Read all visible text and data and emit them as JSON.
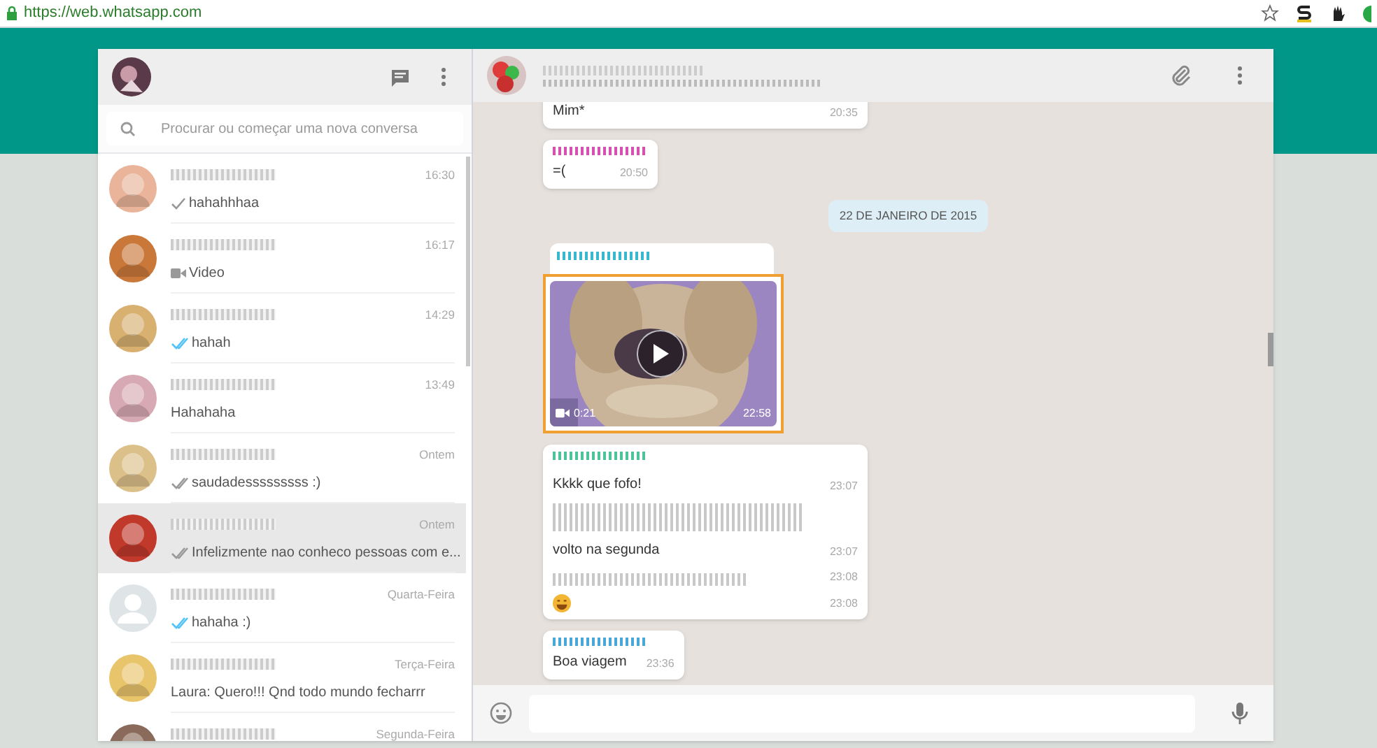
{
  "browser": {
    "url": "https://web.whatsapp.com"
  },
  "sidebar": {
    "search": {
      "placeholder": "Procurar ou começar uma nova conversa"
    },
    "chats": [
      {
        "time": "16:30",
        "receipt": {
          "kind": "sent"
        },
        "preview": "hahahhhaa",
        "selected": false
      },
      {
        "time": "16:17",
        "receipt": {
          "kind": "video"
        },
        "preview": "Video",
        "selected": false
      },
      {
        "time": "14:29",
        "receipt": {
          "kind": "read"
        },
        "preview": "hahah",
        "selected": false
      },
      {
        "time": "13:49",
        "preview": "Hahahaha",
        "selected": false
      },
      {
        "time": "Ontem",
        "receipt": {
          "kind": "delivered"
        },
        "preview": "saudadesssssssss :)",
        "selected": false
      },
      {
        "time": "Ontem",
        "receipt": {
          "kind": "delivered"
        },
        "preview": "Infelizmente nao conheco pessoas com e...",
        "selected": true
      },
      {
        "time": "Quarta-Feira",
        "receipt": {
          "kind": "read"
        },
        "preview": "hahaha :)",
        "selected": false,
        "avatar": {
          "kind": "placeholder"
        }
      },
      {
        "time": "Terça-Feira",
        "preview": "Laura: Quero!!! Qnd todo mundo fecharrr",
        "selected": false
      },
      {
        "time": "Segunda-Feira",
        "selected": false
      }
    ]
  },
  "conversation": {
    "messages": [
      {
        "kind": "text",
        "text": "Mim*",
        "time": "20:35"
      },
      {
        "kind": "text",
        "sender": {
          "color": "#d94fb0"
        },
        "text": "=(",
        "time": "20:50"
      },
      {
        "kind": "date",
        "text": "22 DE JANEIRO DE 2015"
      },
      {
        "kind": "video",
        "sender": {
          "color": "#38b8cc"
        },
        "duration": "0:21",
        "time": "22:58",
        "selected": true
      },
      {
        "kind": "group",
        "sender": {
          "color": "#4cc49a"
        },
        "lines": [
          {
            "text": "Kkkk que fofo!",
            "time": "23:07"
          },
          {
            "redacted": true,
            "text": "volto na segunda",
            "time": "23:07"
          },
          {
            "redacted": true,
            "time": "23:08"
          },
          {
            "emoji": true,
            "time": "23:08"
          }
        ]
      },
      {
        "kind": "text",
        "sender": {
          "color": "#4aa8d8"
        },
        "text": "Boa viagem",
        "time": "23:36"
      }
    ]
  }
}
